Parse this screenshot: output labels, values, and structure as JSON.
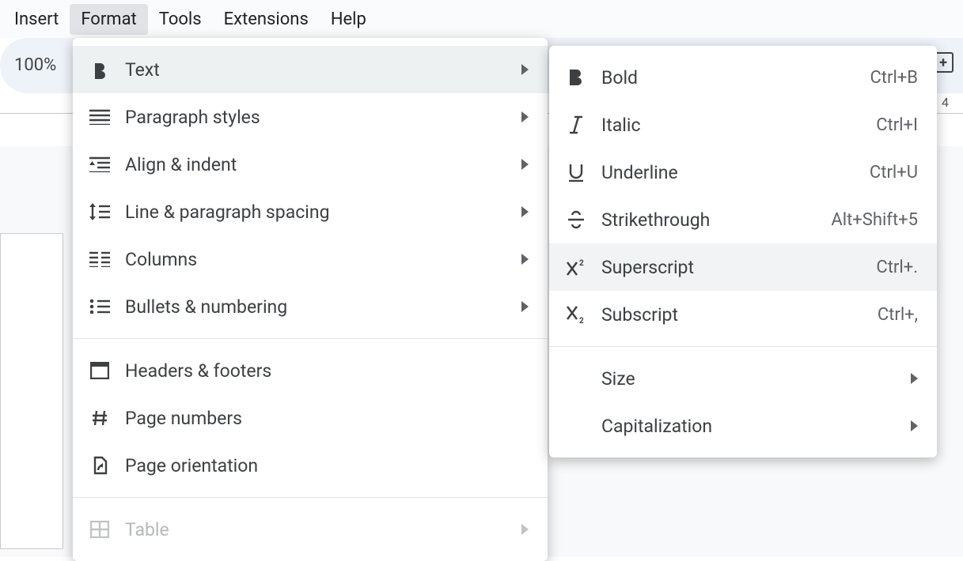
{
  "menubar": {
    "items": [
      {
        "label": "Insert"
      },
      {
        "label": "Format"
      },
      {
        "label": "Tools"
      },
      {
        "label": "Extensions"
      },
      {
        "label": "Help"
      }
    ],
    "active_index": 1
  },
  "toolbar": {
    "zoom": "100%",
    "right_glyph": "+"
  },
  "ruler": {
    "mark": "4"
  },
  "format_menu": {
    "groups": [
      [
        {
          "icon": "bold-icon",
          "label": "Text",
          "arrow": true,
          "highlight": true
        },
        {
          "icon": "paragraph-styles-icon",
          "label": "Paragraph styles",
          "arrow": true
        },
        {
          "icon": "align-indent-icon",
          "label": "Align & indent",
          "arrow": true
        },
        {
          "icon": "line-spacing-icon",
          "label": "Line & paragraph spacing",
          "arrow": true
        },
        {
          "icon": "columns-icon",
          "label": "Columns",
          "arrow": true
        },
        {
          "icon": "bullets-numbering-icon",
          "label": "Bullets & numbering",
          "arrow": true
        }
      ],
      [
        {
          "icon": "headers-footers-icon",
          "label": "Headers & footers"
        },
        {
          "icon": "page-numbers-icon",
          "label": "Page numbers"
        },
        {
          "icon": "page-orientation-icon",
          "label": "Page orientation"
        }
      ],
      [
        {
          "icon": "table-icon",
          "label": "Table",
          "arrow": true,
          "disabled": true
        }
      ]
    ]
  },
  "text_submenu": {
    "groups": [
      [
        {
          "icon": "bold-icon",
          "label": "Bold",
          "shortcut": "Ctrl+B"
        },
        {
          "icon": "italic-icon",
          "label": "Italic",
          "shortcut": "Ctrl+I"
        },
        {
          "icon": "underline-icon",
          "label": "Underline",
          "shortcut": "Ctrl+U"
        },
        {
          "icon": "strikethrough-icon",
          "label": "Strikethrough",
          "shortcut": "Alt+Shift+5"
        },
        {
          "icon": "superscript-icon",
          "label": "Superscript",
          "shortcut": "Ctrl+.",
          "hover": true
        },
        {
          "icon": "subscript-icon",
          "label": "Subscript",
          "shortcut": "Ctrl+,"
        }
      ],
      [
        {
          "label": "Size",
          "arrow": true
        },
        {
          "label": "Capitalization",
          "arrow": true
        }
      ]
    ]
  }
}
